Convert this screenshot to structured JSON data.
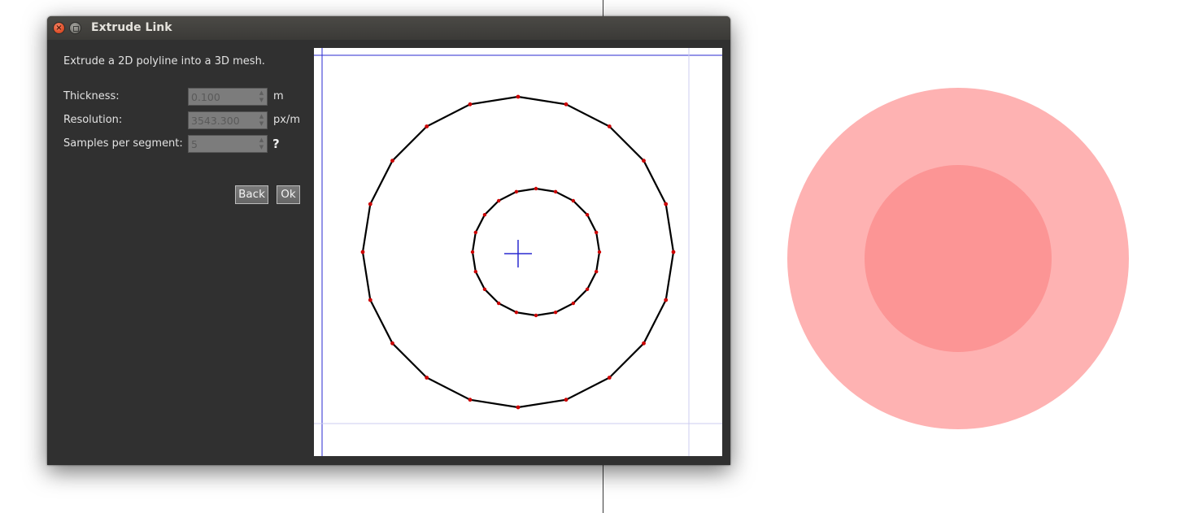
{
  "window": {
    "title": "Extrude Link"
  },
  "description": "Extrude a 2D polyline into a 3D mesh.",
  "fields": {
    "thickness": {
      "label": "Thickness:",
      "value": "0.100",
      "unit": "m"
    },
    "resolution": {
      "label": "Resolution:",
      "value": "3543.300",
      "unit": "px/m"
    },
    "samples": {
      "label": "Samples per segment:",
      "value": "5",
      "help": "?"
    }
  },
  "buttons": {
    "back": "Back",
    "ok": "Ok"
  },
  "icons": {
    "close": "close-icon",
    "minimize": "minimize-icon",
    "spin_up": "chevron-up-icon",
    "spin_down": "chevron-down-icon",
    "origin": "crosshair-icon"
  },
  "colors": {
    "window_bg": "#303030",
    "polyline": "#000000",
    "vertex": "#cc0000",
    "guide": "#2a2ad0",
    "outer_disc": "#feb2b2",
    "inner_disc": "#fc9595"
  },
  "preview": {
    "outer_polyline_vertices": 20,
    "inner_polyline_vertices": 20
  }
}
